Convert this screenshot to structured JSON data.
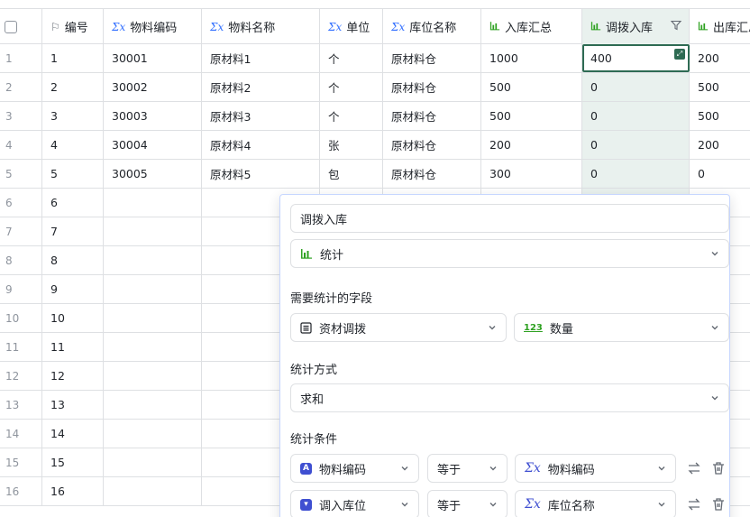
{
  "columns": [
    {
      "icon": "checkbox-icon",
      "label": ""
    },
    {
      "icon": "flag-icon",
      "label": "编号"
    },
    {
      "icon": "formula-icon",
      "label": "物料编码"
    },
    {
      "icon": "formula-icon",
      "label": "物料名称"
    },
    {
      "icon": "formula-icon",
      "label": "单位"
    },
    {
      "icon": "formula-icon",
      "label": "库位名称"
    },
    {
      "icon": "stats-icon",
      "label": "入库汇总"
    },
    {
      "icon": "stats-icon",
      "label": "调拨入库"
    },
    {
      "icon": "stats-icon",
      "label": "出库汇总"
    }
  ],
  "rows": [
    {
      "rn": "1",
      "id": "1",
      "code": "30001",
      "name": "原材料1",
      "unit": "个",
      "loc": "原材料仓",
      "in": "1000",
      "transfer": "400",
      "out": "200"
    },
    {
      "rn": "2",
      "id": "2",
      "code": "30002",
      "name": "原材料2",
      "unit": "个",
      "loc": "原材料仓",
      "in": "500",
      "transfer": "0",
      "out": "500"
    },
    {
      "rn": "3",
      "id": "3",
      "code": "30003",
      "name": "原材料3",
      "unit": "个",
      "loc": "原材料仓",
      "in": "500",
      "transfer": "0",
      "out": "500"
    },
    {
      "rn": "4",
      "id": "4",
      "code": "30004",
      "name": "原材料4",
      "unit": "张",
      "loc": "原材料仓",
      "in": "200",
      "transfer": "0",
      "out": "200"
    },
    {
      "rn": "5",
      "id": "5",
      "code": "30005",
      "name": "原材料5",
      "unit": "包",
      "loc": "原材料仓",
      "in": "300",
      "transfer": "0",
      "out": "0"
    },
    {
      "rn": "6",
      "id": "6"
    },
    {
      "rn": "7",
      "id": "7"
    },
    {
      "rn": "8",
      "id": "8"
    },
    {
      "rn": "9",
      "id": "9"
    },
    {
      "rn": "10",
      "id": "10"
    },
    {
      "rn": "11",
      "id": "11"
    },
    {
      "rn": "12",
      "id": "12"
    },
    {
      "rn": "13",
      "id": "13"
    },
    {
      "rn": "14",
      "id": "14"
    },
    {
      "rn": "15",
      "id": "15"
    },
    {
      "rn": "16",
      "id": "16"
    }
  ],
  "popup": {
    "field_name": "调拨入库",
    "field_type": "统计",
    "stat_field_label": "需要统计的字段",
    "source_table": "资材调拨",
    "source_field": "数量",
    "method_label": "统计方式",
    "method": "求和",
    "conditions_label": "统计条件",
    "conditions": [
      {
        "left": "物料编码",
        "left_icon": "text-type-icon",
        "op": "等于",
        "right": "物料编码"
      },
      {
        "left": "调入库位",
        "left_icon": "single-select-icon",
        "op": "等于",
        "right": "库位名称"
      }
    ]
  },
  "colors": {
    "accent_green": "#2e6b53",
    "highlight_bg": "#e9f1ee",
    "formula_blue": "#3370ff",
    "popup_border": "#c6d6ff"
  }
}
